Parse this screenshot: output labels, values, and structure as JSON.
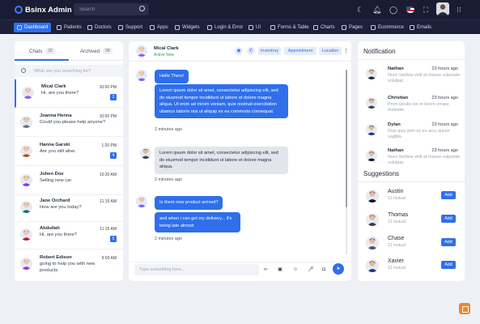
{
  "app": {
    "title": "Bsinx Admin"
  },
  "header": {
    "search_placeholder": "Search"
  },
  "nav": {
    "items": [
      {
        "label": "Dashboard",
        "active": true
      },
      {
        "label": "Patients"
      },
      {
        "label": "Doctors"
      },
      {
        "label": "Support"
      },
      {
        "label": "Apps"
      },
      {
        "label": "Widgets"
      },
      {
        "label": "Login & Error"
      },
      {
        "label": "UI"
      },
      {
        "label": "Forms & Table"
      },
      {
        "label": "Charts"
      },
      {
        "label": "Pages"
      },
      {
        "label": "Ecommerce"
      },
      {
        "label": "Emails"
      }
    ]
  },
  "chats": {
    "tabs": [
      {
        "label": "Chats",
        "count": "32"
      },
      {
        "label": "Archived",
        "count": "08"
      }
    ],
    "search_placeholder": "What are you searching for?",
    "items": [
      {
        "name": "Mical Clark",
        "message": "Hi, are you there?",
        "time": "10:00 PM",
        "badge": "2",
        "avatar_color": "#8b5cf6"
      },
      {
        "name": "Joanna Henna",
        "message": "Could you please help anyone?",
        "time": "10:00 PM",
        "badge": "",
        "avatar_color": "#6b7280"
      },
      {
        "name": "Hanna Garski",
        "message": "Are you still alive.",
        "time": "1:20 PM",
        "badge": "4",
        "avatar_color": "#b45309"
      },
      {
        "name": "Johen Doe",
        "message": "Selling new car",
        "time": "10:30 AM",
        "badge": "",
        "avatar_color": "#7c3aed"
      },
      {
        "name": "Jane Orchard",
        "message": "How are you today?",
        "time": "11:15 AM",
        "badge": "",
        "avatar_color": "#0f766e"
      },
      {
        "name": "Abdullah",
        "message": "Hi, are you there?",
        "time": "11:15 AM",
        "badge": "5",
        "avatar_color": "#be123c"
      },
      {
        "name": "Robert Edison",
        "message": "going to help you with new products.",
        "time": "9:00 AM",
        "badge": "",
        "avatar_color": "#9333ea"
      }
    ]
  },
  "conversation": {
    "contact": {
      "name": "Mical Clark",
      "status": "Active Now"
    },
    "actions": [
      "Inventory",
      "Appointment",
      "Location"
    ],
    "messages": [
      {
        "side": "in",
        "bubbles": [
          "Hello There!",
          "Lorem ipsum dolor sit amet, consectetur adipiscing elit, sed do eiusmod tempor incididunt ut labore et dolore magna aliqua. Ut enim ad minim veniam, quis nostrud exercitation ullamco laboris nisi ut aliquip ex ea commodo consequat."
        ],
        "time": "2 minutes ago"
      },
      {
        "side": "out",
        "bubbles": [
          "Lorem ipsum dolor sit amet, consectetur adipiscing elit, sed do eiusmod tempor incididunt ut labore et dolore magna aliqua."
        ],
        "time": "2 minutes ago"
      },
      {
        "side": "in",
        "bubbles": [
          "Is there new product arrived?",
          "and when i can get my delivery... it's being late almost"
        ],
        "time": "2 minutes ago"
      }
    ],
    "composer_placeholder": "Type something here..."
  },
  "notifications": {
    "title": "Notification",
    "items": [
      {
        "name": "Nathan",
        "time": "23 hours ago",
        "text": "Nunc facilisis velit at massa vulputate volutpat.",
        "avatar_color": "#1f2937"
      },
      {
        "name": "Christian",
        "time": "23 hours ago",
        "text": "Proin iaculis est et lorem ornare molestie.",
        "avatar_color": "#374151"
      },
      {
        "name": "Dylan",
        "time": "23 hours ago",
        "text": "Duis quis sem ex eu arcu auctor sagittis.",
        "avatar_color": "#1e3a8a"
      },
      {
        "name": "Nathan",
        "time": "23 hours ago",
        "text": "Nunc facilisis velit at massa vulputate volutpat.",
        "avatar_color": "#111827"
      }
    ]
  },
  "suggestions": {
    "title": "Suggestions",
    "add_label": "Add",
    "items": [
      {
        "name": "Austin",
        "mutual": "12 mutual",
        "avatar_color": "#111827"
      },
      {
        "name": "Thomas",
        "mutual": "12 mutual",
        "avatar_color": "#374151"
      },
      {
        "name": "Chase",
        "mutual": "12 mutual",
        "avatar_color": "#4b5563"
      },
      {
        "name": "Xavier",
        "mutual": "12 mutual",
        "avatar_color": "#1e3a8a"
      }
    ]
  }
}
